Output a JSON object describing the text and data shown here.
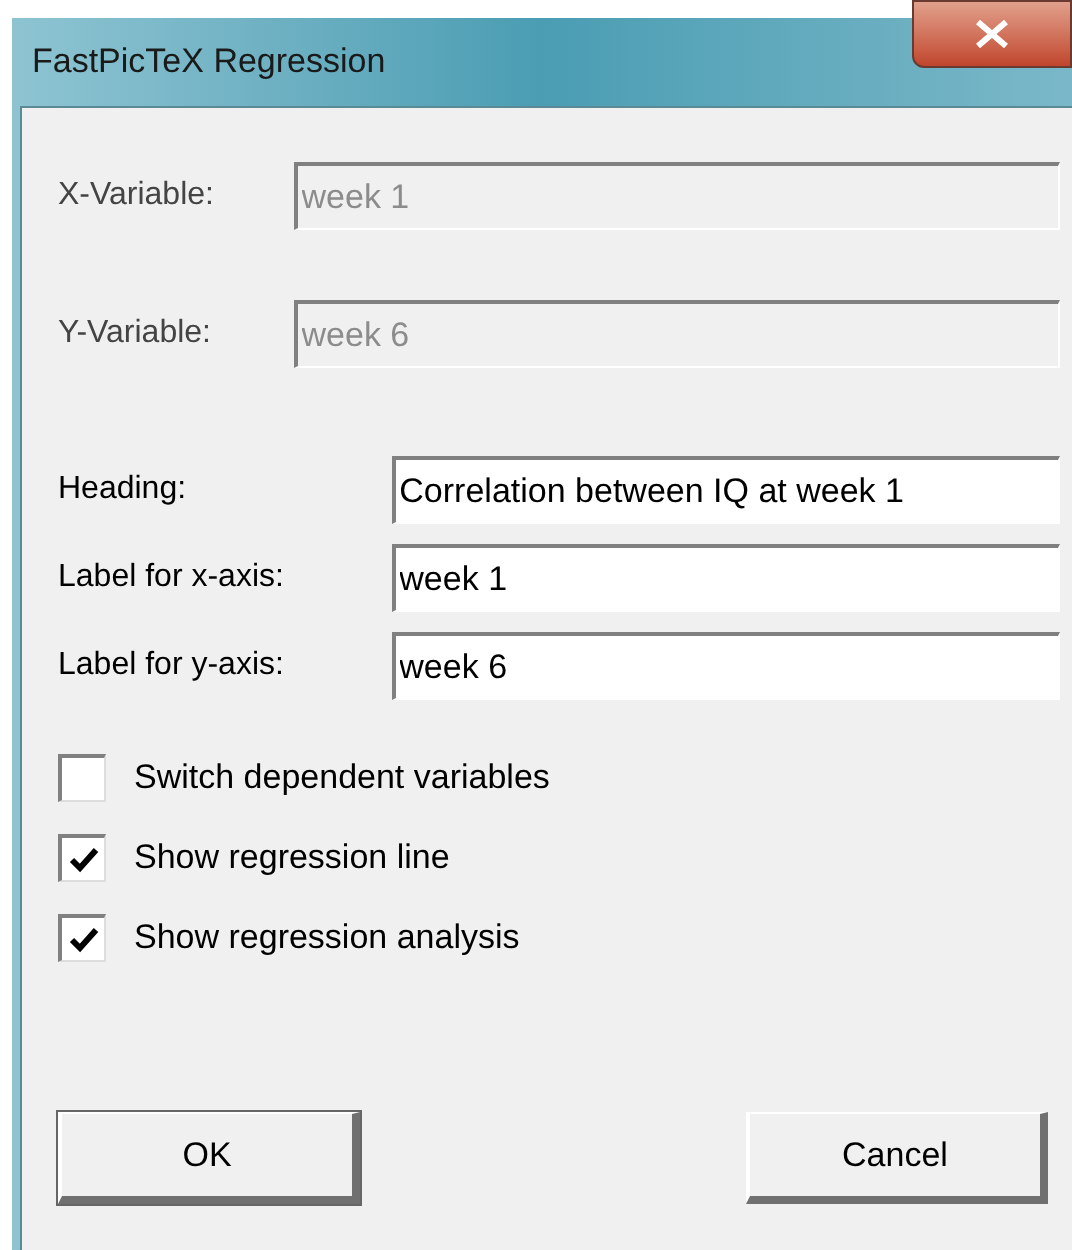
{
  "window": {
    "title": "FastPicTeX Regression"
  },
  "variables": [
    {
      "label": "X-Variable:",
      "value": "week 1",
      "disabled": true
    },
    {
      "label": "Y-Variable:",
      "value": "week 6",
      "disabled": true
    }
  ],
  "fields": [
    {
      "label": "Heading:",
      "value": "Correlation between IQ at week 1"
    },
    {
      "label": "Label for x-axis:",
      "value": "week 1"
    },
    {
      "label": "Label for y-axis:",
      "value": "week 6"
    }
  ],
  "options": [
    {
      "label": "Switch dependent variables",
      "checked": false
    },
    {
      "label": "Show regression line",
      "checked": true
    },
    {
      "label": "Show regression analysis",
      "checked": true
    }
  ],
  "buttons": [
    "OK",
    "Cancel"
  ]
}
